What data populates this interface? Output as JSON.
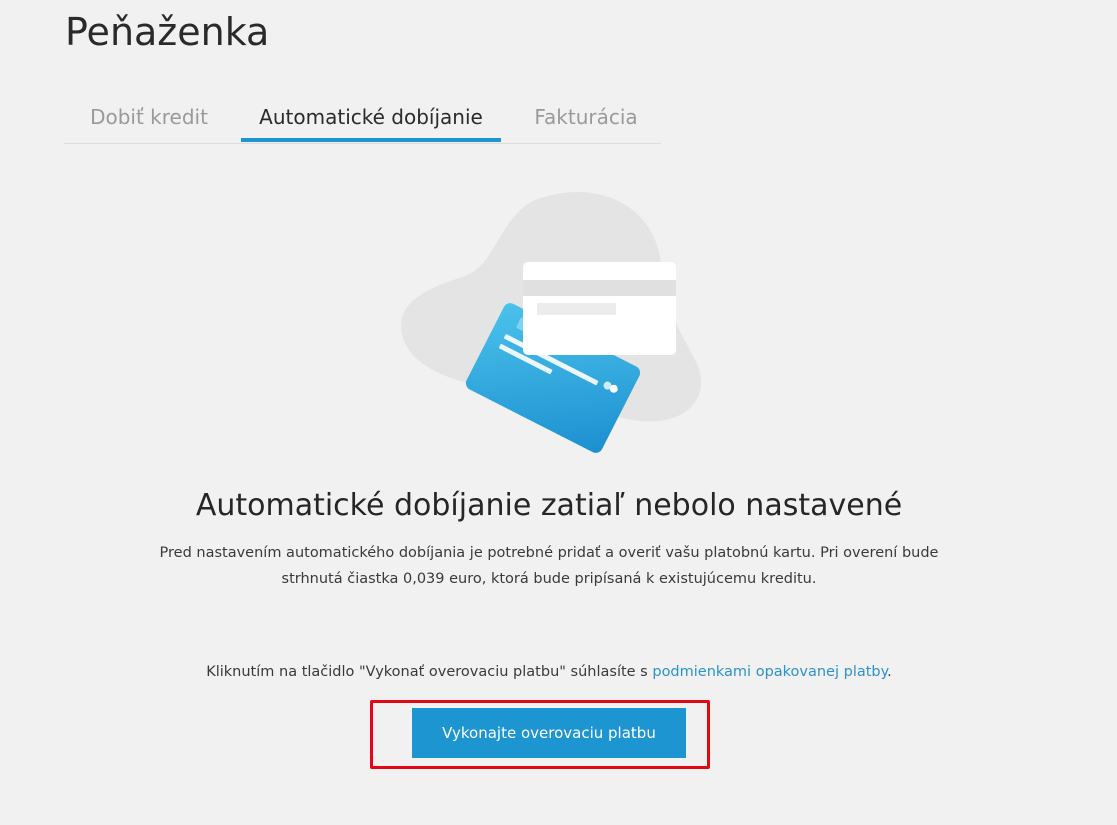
{
  "page": {
    "title": "Peňaženka"
  },
  "tabs": [
    {
      "label": "Dobiť kredit",
      "active": false
    },
    {
      "label": "Automatické dobíjanie",
      "active": true
    },
    {
      "label": "Fakturácia",
      "active": false
    }
  ],
  "illustration": {
    "icon": "credit-cards-icon",
    "colors": {
      "blob": "#e6e6e6",
      "card_front": "#ffffff",
      "card_back_from": "#4bc3ec",
      "card_back_to": "#1c95d1"
    }
  },
  "empty_state": {
    "title": "Automatické dobíjanie zatiaľ nebolo nastavené",
    "description": "Pred nastavením automatického dobíjania je potrebné pridať a overiť vašu platobnú kartu. Pri overení bude strhnutá čiastka 0,039 euro, ktorá bude pripísaná k existujúcemu kreditu."
  },
  "consent": {
    "prefix": "Kliknutím na tlačidlo \"Vykonať overovaciu platbu\" súhlasíte s ",
    "link_label": "podmienkami opakovanej platby",
    "suffix": "."
  },
  "actions": {
    "verify_button_label": "Vykonajte overovaciu platbu"
  },
  "colors": {
    "accent": "#1c95d1",
    "highlight": "#e30613",
    "background": "#f1f1f1"
  }
}
